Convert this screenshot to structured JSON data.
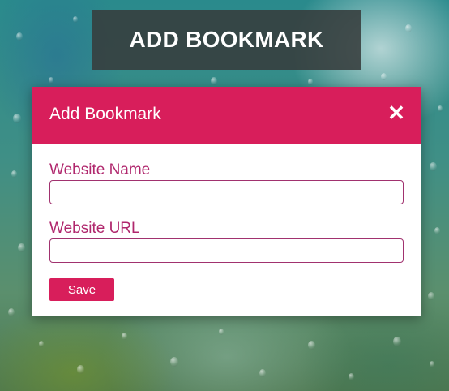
{
  "page": {
    "hero_title": "ADD BOOKMARK"
  },
  "modal": {
    "title": "Add Bookmark",
    "close_icon": "close-icon",
    "close_glyph": "✕",
    "fields": [
      {
        "label": "Website Name",
        "value": "",
        "placeholder": ""
      },
      {
        "label": "Website URL",
        "value": "",
        "placeholder": ""
      }
    ],
    "save_label": "Save"
  },
  "colors": {
    "accent": "#d81e5b",
    "label": "#b0276d",
    "input_border": "#a1326f",
    "hero_bg": "#373c3c"
  }
}
